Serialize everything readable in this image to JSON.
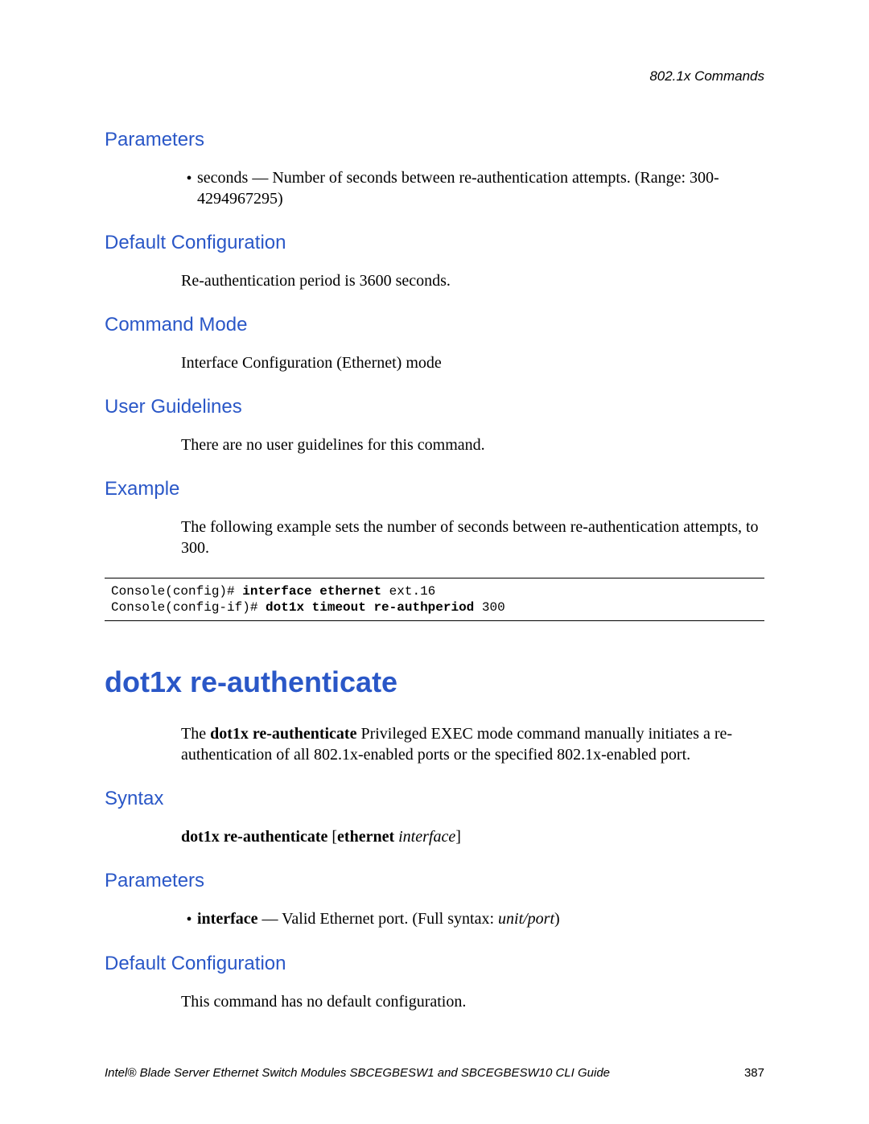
{
  "header": {
    "right": "802.1x Commands"
  },
  "section1": {
    "parameters_heading": "Parameters",
    "parameters_bullet": "seconds — Number of seconds between re-authentication attempts. (Range: 300-4294967295)",
    "default_config_heading": "Default Configuration",
    "default_config_body": "Re-authentication period is 3600 seconds.",
    "command_mode_heading": "Command Mode",
    "command_mode_body": "Interface Configuration (Ethernet) mode",
    "user_guidelines_heading": "User Guidelines",
    "user_guidelines_body": "There are no user guidelines for this command.",
    "example_heading": "Example",
    "example_body": "The following example sets the number of seconds between re-authentication attempts, to 300.",
    "code": {
      "line1_prefix": "Console(config)# ",
      "line1_bold": "interface ethernet ",
      "line1_suffix": "ext.16",
      "line2_prefix": "Console(config-if)# ",
      "line2_bold": "dot1x timeout re-authperiod ",
      "line2_suffix": "300"
    }
  },
  "section2": {
    "title": "dot1x re-authenticate",
    "intro_prefix": "The ",
    "intro_bold": "dot1x re-authenticate",
    "intro_suffix": " Privileged EXEC mode command manually initiates a re-authentication of all 802.1x-enabled ports or the specified 802.1x-enabled port.",
    "syntax_heading": "Syntax",
    "syntax_bold1": "dot1x re-authenticate ",
    "syntax_plain1": "[",
    "syntax_bold2": "ethernet ",
    "syntax_italic": "interface",
    "syntax_plain2": "]",
    "parameters_heading": "Parameters",
    "param_bold": "interface",
    "param_mid": " — Valid Ethernet port. (Full syntax: ",
    "param_italic": "unit/port",
    "param_end": ")",
    "default_config_heading": "Default Configuration",
    "default_config_body": "This command has no default configuration."
  },
  "footer": {
    "left": "Intel® Blade Server Ethernet Switch Modules SBCEGBESW1 and SBCEGBESW10 CLI Guide",
    "right": "387"
  }
}
